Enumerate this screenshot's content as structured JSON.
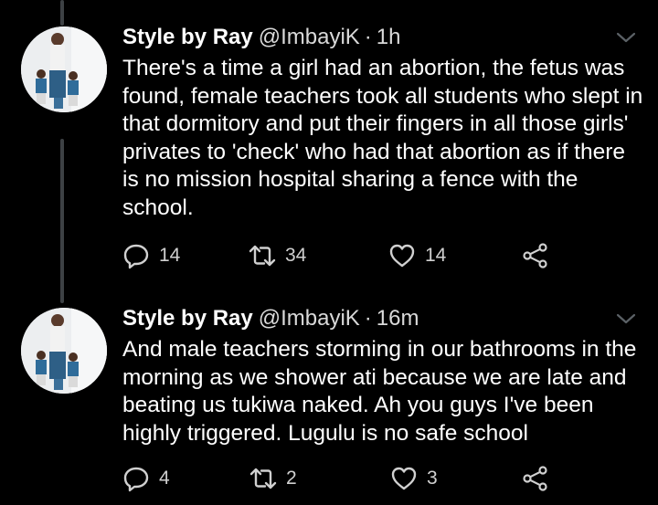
{
  "colors": {
    "background": "#000000",
    "text": "#ffffff",
    "secondary_text": "#d9d9d9",
    "icon": "#d0d0d0",
    "thread_line": "#3d4144"
  },
  "tweets": [
    {
      "display_name": "Style by Ray",
      "handle": "@ImbayiK",
      "separator": "·",
      "time": "1h",
      "text": "There's a time a girl had an abortion, the fetus was found, female teachers took all students who slept in that dormitory and put their fingers in all those girls' privates to 'check' who had that abortion as if there is no mission hospital sharing a fence with the school.",
      "reply_count": "14",
      "retweet_count": "34",
      "like_count": "14",
      "icons": [
        "reply-icon",
        "retweet-icon",
        "like-icon",
        "share-icon",
        "chevron-down-icon"
      ]
    },
    {
      "display_name": "Style by Ray",
      "handle": "@ImbayiK",
      "separator": "·",
      "time": "16m",
      "text": "And male teachers storming in our bathrooms in the morning as we shower ati because we are late and beating us tukiwa naked. Ah you guys I've been highly triggered. Lugulu is no safe school",
      "reply_count": "4",
      "retweet_count": "2",
      "like_count": "3",
      "icons": [
        "reply-icon",
        "retweet-icon",
        "like-icon",
        "share-icon",
        "chevron-down-icon"
      ]
    }
  ]
}
